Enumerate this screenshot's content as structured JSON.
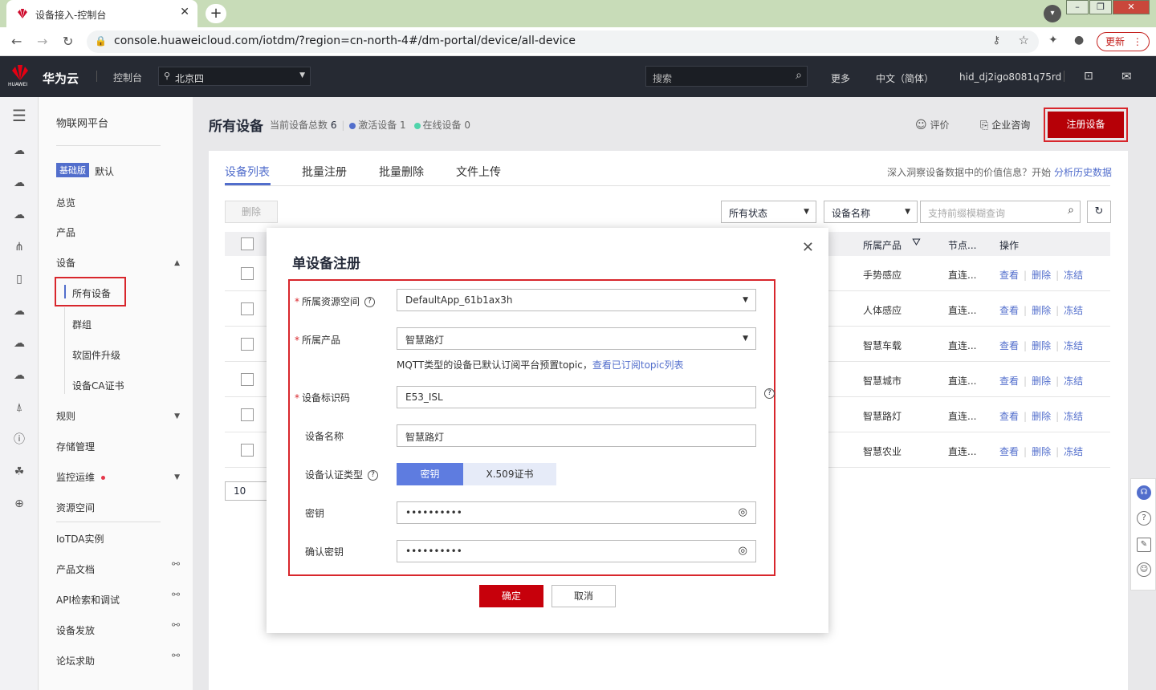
{
  "browser": {
    "tab_title": "设备接入-控制台",
    "url": "console.huaweicloud.com/iotdm/?region=cn-north-4#/dm-portal/device/all-device",
    "update_label": "更新"
  },
  "topnav": {
    "brand": "华为云",
    "logo_text": "HUAWEI",
    "console": "控制台",
    "region": "北京四",
    "search_placeholder": "搜索",
    "more": "更多",
    "language": "中文（简体）",
    "user": "hid_dj2igo8081q75rd"
  },
  "sidebar": {
    "title": "物联网平台",
    "edition_badge": "基础版",
    "edition_name": "默认",
    "items": {
      "overview": "总览",
      "products": "产品",
      "devices": "设备",
      "all_devices": "所有设备",
      "groups": "群组",
      "firmware": "软固件升级",
      "device_ca": "设备CA证书",
      "rules": "规则",
      "storage": "存储管理",
      "monitoring": "监控运维",
      "resource_space": "资源空间",
      "iotda_instance": "IoTDA实例",
      "product_docs": "产品文档",
      "api_explorer": "API检索和调试",
      "device_provisioning": "设备发放",
      "forum": "论坛求助"
    }
  },
  "main": {
    "title": "所有设备",
    "stats": {
      "total_label": "当前设备总数",
      "total": "6",
      "activated_label": "激活设备",
      "activated": "1",
      "online_label": "在线设备",
      "online": "0"
    },
    "evaluate": "评价",
    "consult": "企业咨询",
    "register_button": "注册设备",
    "tabs": [
      "设备列表",
      "批量注册",
      "批量删除",
      "文件上传"
    ],
    "insight_text": "深入洞察设备数据中的价值信息？开始",
    "insight_link": "分析历史数据",
    "delete_button": "删除",
    "status_filter": "所有状态",
    "field_filter": "设备名称",
    "search_placeholder": "支持前缀模糊查询",
    "columns": {
      "product": "所属产品",
      "node": "节点...",
      "ops": "操作"
    },
    "rows": [
      {
        "product": "手势感应",
        "node": "直连..."
      },
      {
        "product": "人体感应",
        "node": "直连..."
      },
      {
        "product": "智慧车载",
        "node": "直连..."
      },
      {
        "product": "智慧城市",
        "node": "直连..."
      },
      {
        "product": "智慧路灯",
        "node": "直连..."
      },
      {
        "product": "智慧农业",
        "node": "直连..."
      }
    ],
    "op_labels": {
      "view": "查看",
      "delete": "删除",
      "freeze": "冻结"
    },
    "page_size": "10"
  },
  "modal": {
    "title": "单设备注册",
    "fields": {
      "resource_space_label": "所属资源空间",
      "resource_space_value": "DefaultApp_61b1ax3h",
      "product_label": "所属产品",
      "product_value": "智慧路灯",
      "mqtt_hint": "MQTT类型的设备已默认订阅平台预置topic，",
      "mqtt_hint_link": "查看已订阅topic列表",
      "node_id_label": "设备标识码",
      "node_id_value": "E53_ISL",
      "device_name_label": "设备名称",
      "device_name_value": "智慧路灯",
      "auth_type_label": "设备认证类型",
      "auth_secret": "密钥",
      "auth_x509": "X.509证书",
      "secret_label": "密钥",
      "secret_value": "••••••••••",
      "confirm_secret_label": "确认密钥",
      "confirm_secret_value": "••••••••••"
    },
    "ok_button": "确定",
    "cancel_button": "取消"
  },
  "colors": {
    "accent": "#526ecc",
    "brand_red": "#c7000b",
    "highlight_frame": "#d8262c"
  }
}
